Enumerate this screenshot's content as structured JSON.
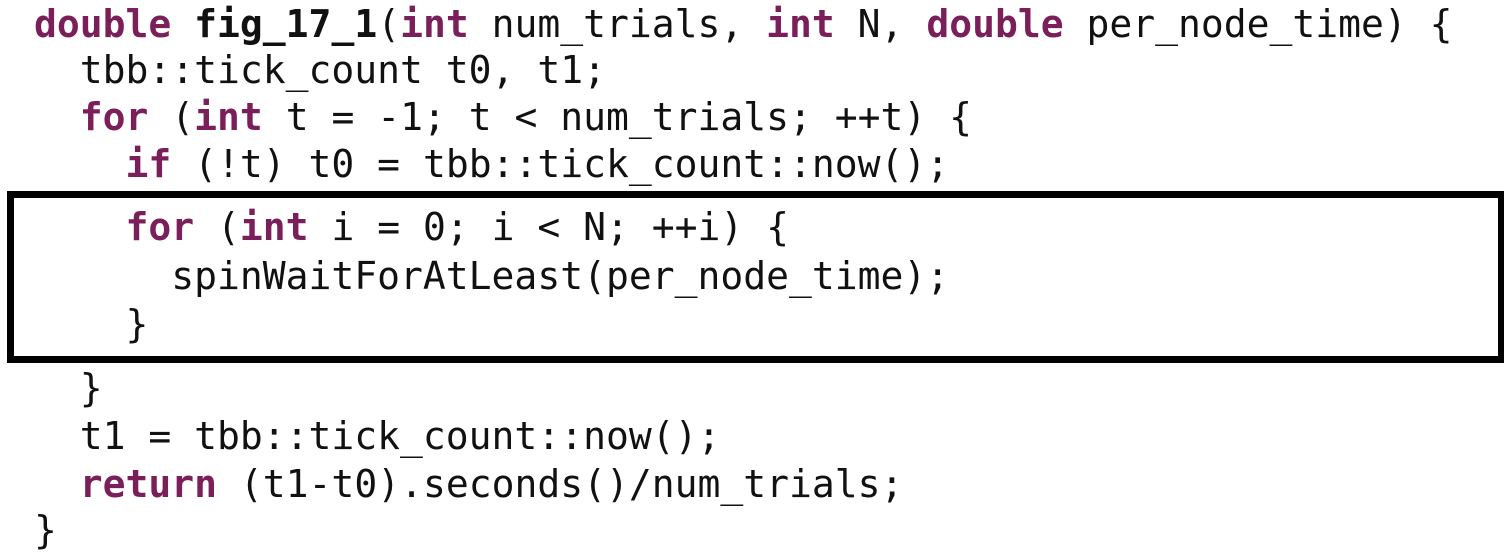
{
  "code": {
    "line1": {
      "kw_double1": "double",
      "sp1": " ",
      "fn_name": "fig_17_1",
      "p_open": "(",
      "kw_int1": "int",
      "arg1": " num_trials, ",
      "kw_int2": "int",
      "arg2": " N, ",
      "kw_double2": "double",
      "arg3": " per_node_time) {"
    },
    "line2": {
      "text": "  tbb::tick_count t0, t1;"
    },
    "line3": {
      "indent": "  ",
      "kw_for": "for",
      "p_open": " (",
      "kw_int": "int",
      "rest": " t = -1; t < num_trials; ++t) {"
    },
    "line4": {
      "indent": "    ",
      "kw_if": "if",
      "rest": " (!t) t0 = tbb::tick_count::now();"
    },
    "line5": {
      "indent": "    ",
      "kw_for": "for",
      "p_open": " (",
      "kw_int": "int",
      "rest": " i = 0; i < N; ++i) {"
    },
    "line6": {
      "text": "      spinWaitForAtLeast(per_node_time);"
    },
    "line7": {
      "text": "    }"
    },
    "line8": {
      "text": "  }"
    },
    "line9": {
      "text": "  t1 = tbb::tick_count::now();"
    },
    "line10": {
      "indent": "  ",
      "kw_return": "return",
      "rest": " (t1-t0).seconds()/num_trials;"
    },
    "line11": {
      "text": "}"
    }
  },
  "colors": {
    "keyword": "#7b1f5b",
    "text": "#111111",
    "highlight_border": "#000000"
  }
}
